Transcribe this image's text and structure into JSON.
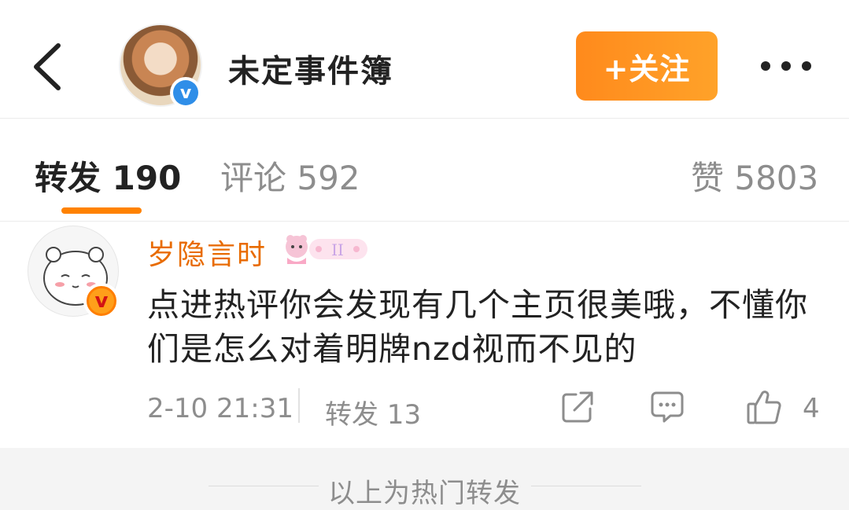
{
  "header": {
    "title": "未定事件簿",
    "follow_label": "+关注",
    "icons": {
      "back": "chevron-left-icon",
      "more": "more-dots-icon",
      "verified": "verified-blue-icon"
    },
    "verify_mark": "v"
  },
  "tabs": [
    {
      "label": "转发 190",
      "active": true
    },
    {
      "label": "评论 592",
      "active": false
    },
    {
      "label": "赞 5803",
      "active": false
    }
  ],
  "post": {
    "username": "岁隐言时",
    "verify_mark": "v",
    "text": "点进热评你会发现有几个主页很美哦，不懂你们是怎么对着明牌nzd视而不见的",
    "time": "2-10 21:31",
    "repost_label": "转发 13",
    "like_count": "4",
    "icons": {
      "share": "share-icon",
      "comment": "comment-icon",
      "like": "thumbs-up-icon",
      "badge": "member-badge-icon"
    }
  },
  "footer": {
    "text": "以上为热门转发"
  },
  "colors": {
    "accent": "#ff8200",
    "username": "#e86b00",
    "follow_bg": "#ff9a22",
    "muted": "#8d8d8d"
  }
}
